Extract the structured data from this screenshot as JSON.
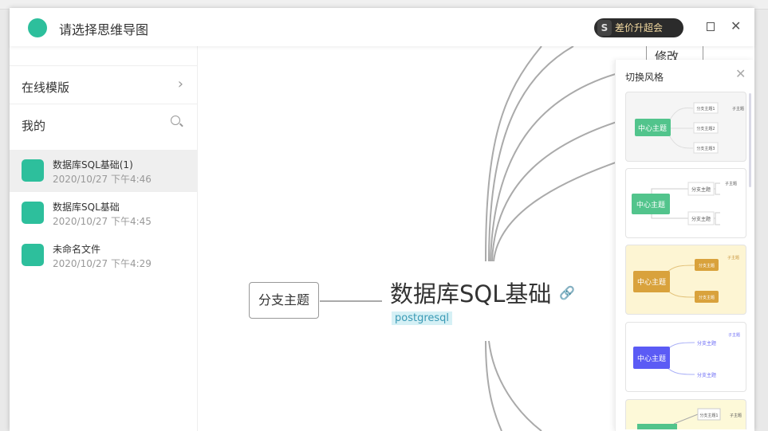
{
  "header": {
    "title": "请选择思维导图",
    "vip": "差价升超会",
    "vip_badge": "S"
  },
  "sidebar": {
    "online_templates": "在线模版",
    "mine": "我的",
    "files": [
      {
        "name": "数据库SQL基础(1)",
        "date": "2020/10/27 下午4:46"
      },
      {
        "name": "数据库SQL基础",
        "date": "2020/10/27 下午4:45"
      },
      {
        "name": "未命名文件",
        "date": "2020/10/27 下午4:29"
      }
    ]
  },
  "canvas": {
    "center": "数据库SQL基础",
    "tag": "postgresql",
    "branch": "分支主题",
    "partial": "修改"
  },
  "panel": {
    "title": "切换风格",
    "thumbs": [
      {
        "center": "中心主题",
        "b1": "分支主题1",
        "b2": "分支主题2",
        "b3": "分支主题3",
        "sub": "子主题"
      },
      {
        "center": "中心主题",
        "b": "分支主题",
        "sub": "子主题"
      },
      {
        "center": "中心主题",
        "b": "分支主题",
        "sub": "子主题"
      },
      {
        "center": "中心主题",
        "b": "分支主题",
        "sub": "子主题"
      },
      {
        "b1": "分支主题1",
        "sub": "子主题"
      }
    ]
  },
  "colors": {
    "accent": "#2dbf9c",
    "green": "#52c48c",
    "gold": "#d9a23c",
    "blue": "#5b5bf5"
  }
}
